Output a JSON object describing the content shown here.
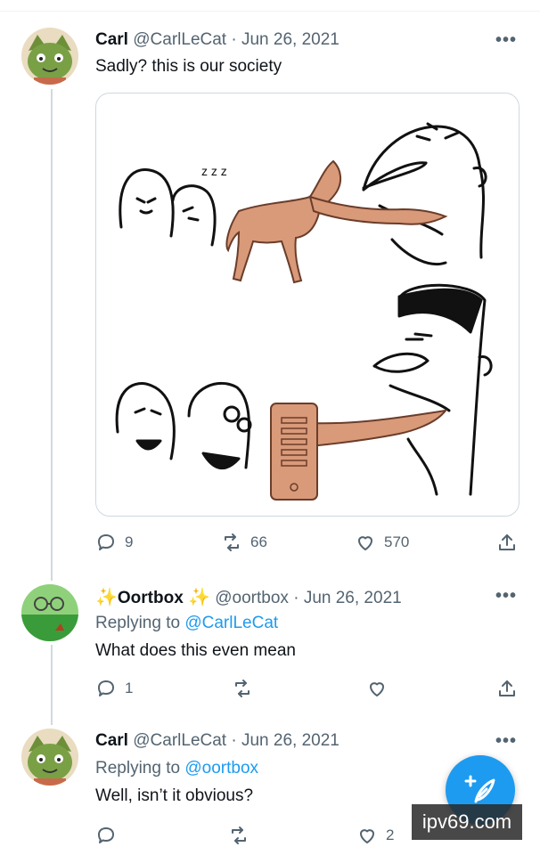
{
  "tweets": [
    {
      "name": "Carl",
      "handle": "@CarlLeCat",
      "date": "· Jun 26, 2021",
      "text": "Sadly? this is our society",
      "replies": "9",
      "retweets": "66",
      "likes": "570"
    },
    {
      "name": "Oortbox",
      "sparkle": "✨",
      "handle": "@oortbox",
      "date": "· Jun 26, 2021",
      "replying_prefix": "Replying to",
      "replying_to": "@CarlLeCat",
      "text": "What does this even mean",
      "replies": "1"
    },
    {
      "name": "Carl",
      "handle": "@CarlLeCat",
      "date": "· Jun 26, 2021",
      "replying_prefix": "Replying to",
      "replying_to": "@oortbox",
      "text": "Well, isn’t it obvious?",
      "likes": "2"
    }
  ],
  "more_label": "•••",
  "watermark": "ipv69.com",
  "colors": {
    "accent": "#1d9bf0",
    "muted": "#536471",
    "text": "#0f1419"
  },
  "icons": [
    "reply-icon",
    "retweet-icon",
    "like-icon",
    "share-icon",
    "compose-icon"
  ]
}
